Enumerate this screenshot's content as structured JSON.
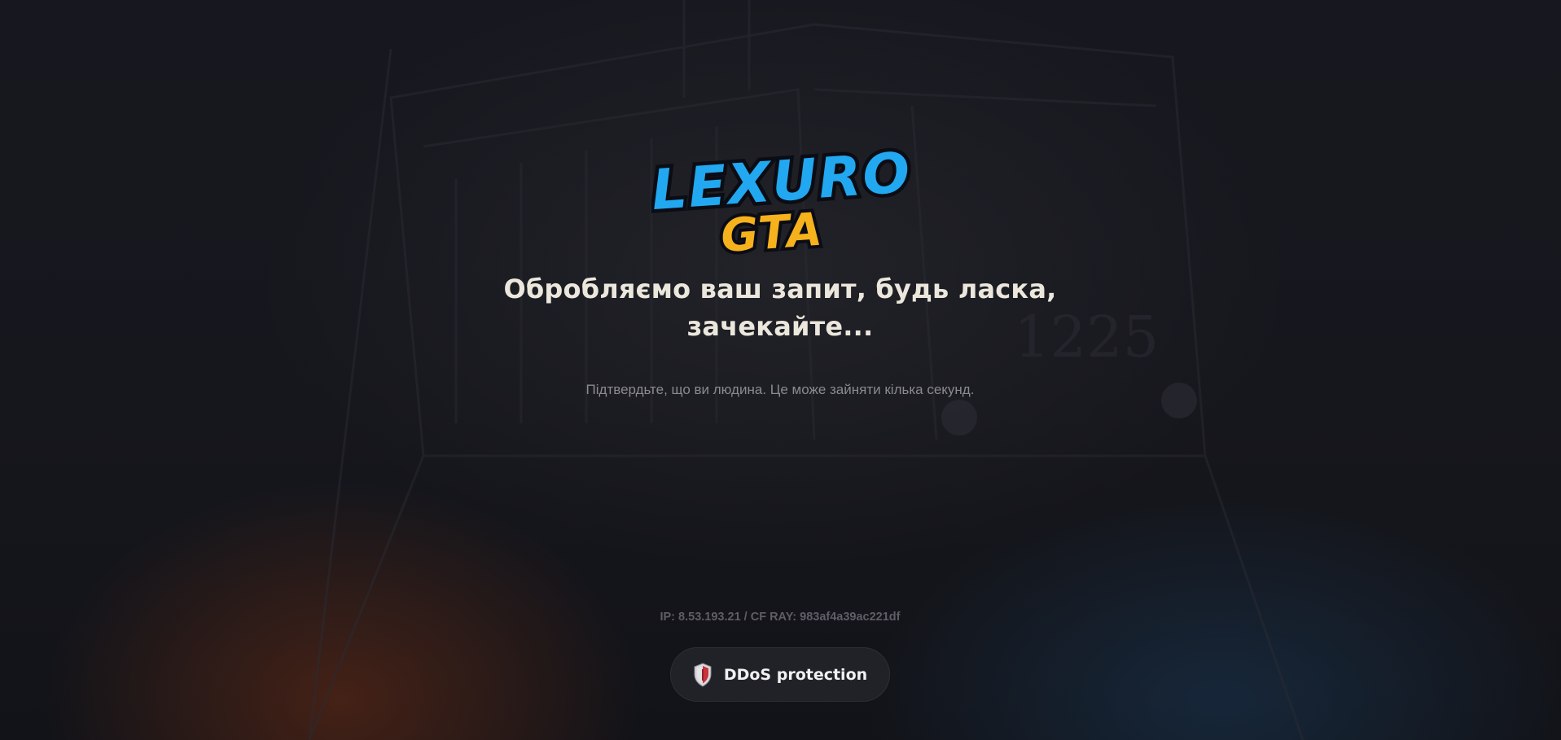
{
  "brand": {
    "line1": "LEXURO",
    "line2": "GTA",
    "color_primary": "#22a8f0",
    "color_secondary": "#f6b21c"
  },
  "main": {
    "title_line1": "Обробляємо ваш запит, будь ласка,",
    "title_line2": "зачекайте...",
    "subtitle": "Підтвердьте, що ви людина. Це може зайняти кілька секунд."
  },
  "footer": {
    "ip_info": "IP: 8.53.193.21 / CF RAY: 983af4a39ac221df",
    "badge_icon": "shield-icon",
    "badge_label": "DDoS protection"
  }
}
